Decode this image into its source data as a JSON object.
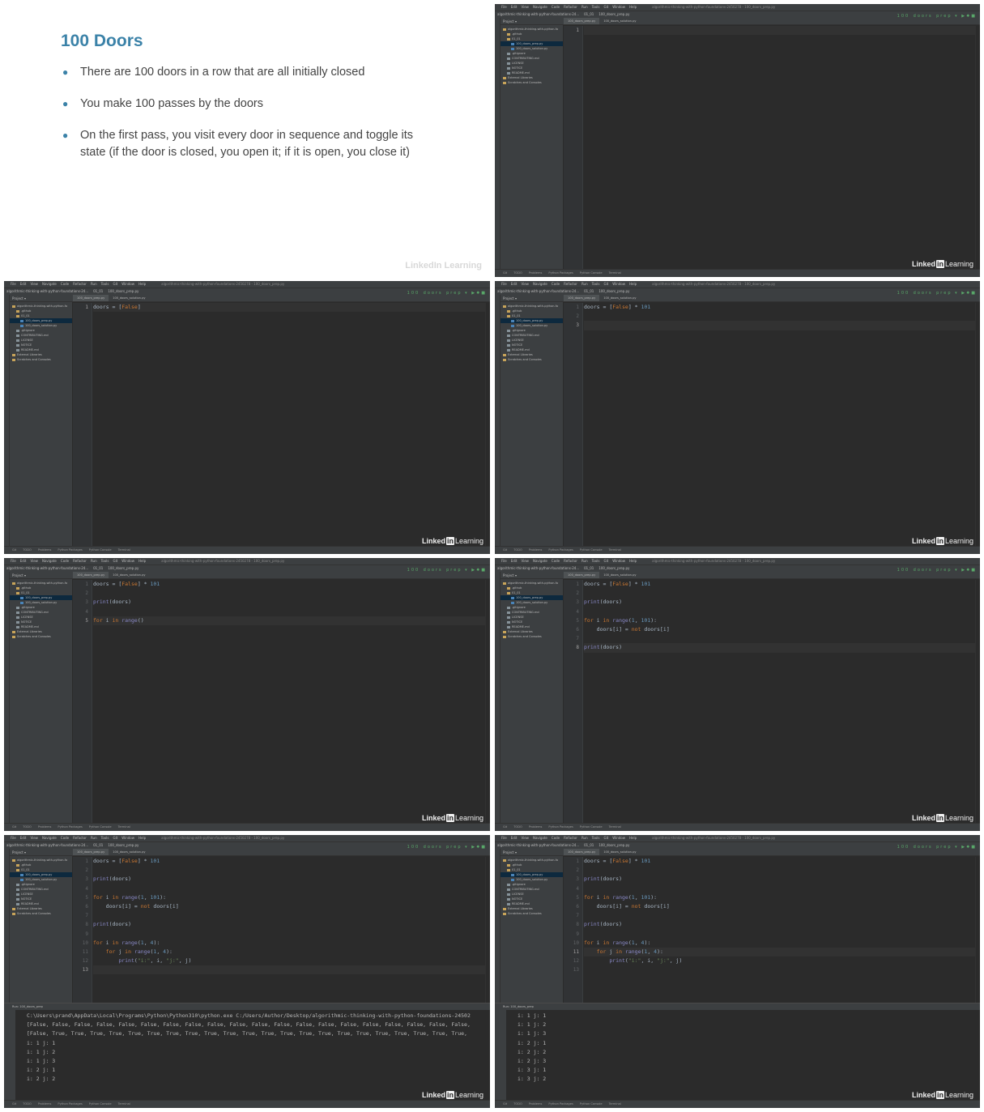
{
  "slide": {
    "title": "100 Doors",
    "bullets": [
      "There are 100 doors in a row that are all initially closed",
      "You make 100 passes by the doors",
      "On the first pass, you visit every door in sequence and toggle its state (if the door is closed, you open it; if it is open, you close it)"
    ],
    "watermark": "LinkedIn Learning"
  },
  "ide": {
    "menu": [
      "File",
      "Edit",
      "View",
      "Navigate",
      "Code",
      "Refactor",
      "Run",
      "Tools",
      "Git",
      "Window",
      "Help"
    ],
    "window_title": "algorithmic-thinking-with-python-foundations-2450278 - 100_doors_prep.py",
    "breadcrumbs": [
      "algorithmic-thinking-with-python-foundations-24...",
      "01_01",
      "100_doors_prep.py"
    ],
    "project_label": "Project",
    "tree": [
      {
        "label": "algorithmic-thinking-with-python-fo",
        "depth": 0,
        "kind": "folder"
      },
      {
        "label": ".github",
        "depth": 1,
        "kind": "folder"
      },
      {
        "label": "01_01",
        "depth": 1,
        "kind": "folder"
      },
      {
        "label": "100_doors_prep.py",
        "depth": 2,
        "kind": "py",
        "selected": true
      },
      {
        "label": "100_doors_solution.py",
        "depth": 2,
        "kind": "py"
      },
      {
        "label": ".gitignore",
        "depth": 1,
        "kind": "file"
      },
      {
        "label": "CONTRIBUTING.md",
        "depth": 1,
        "kind": "file"
      },
      {
        "label": "LICENSE",
        "depth": 1,
        "kind": "file"
      },
      {
        "label": "NOTICE",
        "depth": 1,
        "kind": "file"
      },
      {
        "label": "README.md",
        "depth": 1,
        "kind": "file"
      },
      {
        "label": "External Libraries",
        "depth": 0,
        "kind": "folder"
      },
      {
        "label": "Scratches and Consoles",
        "depth": 0,
        "kind": "folder"
      }
    ],
    "tabs": [
      "100_doors_prep.py",
      "100_doors_solution.py"
    ],
    "status_items": [
      "Git",
      "TODO",
      "Problems",
      "Python Packages",
      "Python Console",
      "Terminal"
    ],
    "run_tab_label": "Run",
    "run_config": "100_doors_prep",
    "watermark": {
      "linked": "Linked",
      "in": "in",
      "learning": "Learning"
    }
  },
  "frames": [
    {
      "lines": [
        ""
      ],
      "cursor_line": 1
    },
    {
      "lines": [
        "doors = [False]"
      ],
      "cursor_line": 1
    },
    {
      "lines": [
        "doors = [False] * 101",
        "",
        ""
      ],
      "cursor_line": 3
    },
    {
      "lines": [
        "doors = [False] * 101",
        "",
        "print(doors)",
        "",
        "for i in range()"
      ],
      "cursor_line": 5
    },
    {
      "lines": [
        "doors = [False] * 101",
        "",
        "print(doors)",
        "",
        "for i in range(1, 101):",
        "    doors[i] = not doors[i]",
        "",
        "print(doors)"
      ],
      "cursor_line": 8
    },
    {
      "lines": [
        "doors = [False] * 101",
        "",
        "print(doors)",
        "",
        "for i in range(1, 101):",
        "    doors[i] = not doors[i]",
        "",
        "print(doors)",
        "",
        "for i in range(1, 4):",
        "    for j in range(1, 4):",
        "        print(\"i:\", i, \"j:\", j)",
        ""
      ],
      "cursor_line": 13,
      "output": [
        "C:\\Users\\prand\\AppData\\Local\\Programs\\Python\\Python310\\python.exe C:/Users/Author/Desktop/algorithmic-thinking-with-python-foundations-24502",
        "[False, False, False, False, False, False, False, False, False, False, False, False, False, False, False, False, False, False, False, False,",
        "[False, True, True, True, True, True, True, True, True, True, True, True, True, True, True, True, True, True, True, True, True, True, True,",
        "i: 1 j: 1",
        "i: 1 j: 2",
        "i: 1 j: 3",
        "i: 2 j: 1",
        "i: 2 j: 2"
      ]
    },
    {
      "lines": [
        "doors = [False] * 101",
        "",
        "print(doors)",
        "",
        "for i in range(1, 101):",
        "    doors[i] = not doors[i]",
        "",
        "print(doors)",
        "",
        "for i in range(1, 4):",
        "    for j in range(1, 4):",
        "        print(\"i:\", i, \"j:\", j)",
        ""
      ],
      "cursor_line": 11,
      "output": [
        "i: 1 j: 1",
        "i: 1 j: 2",
        "i: 1 j: 3",
        "i: 2 j: 1",
        "i: 2 j: 2",
        "i: 2 j: 3",
        "i: 3 j: 1",
        "i: 3 j: 2"
      ]
    }
  ]
}
